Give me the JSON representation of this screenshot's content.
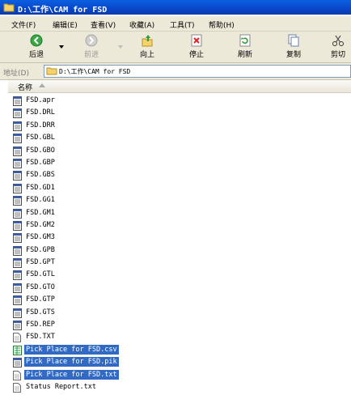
{
  "window": {
    "title": "D:\\工作\\CAM for FSD"
  },
  "menu": [
    "文件(F)",
    "编辑(E)",
    "查看(V)",
    "收藏(A)",
    "工具(T)",
    "帮助(H)"
  ],
  "toolbar": {
    "back": "后退",
    "forward": "前进",
    "up": "向上",
    "stop": "停止",
    "refresh": "刷新",
    "copy": "复制",
    "cut": "剪切"
  },
  "address": {
    "label": "地址(D)",
    "path": "D:\\工作\\CAM for FSD"
  },
  "list": {
    "column_name": "名称",
    "files": [
      "FSD.apr",
      "FSD.DRL",
      "FSD.DRR",
      "FSD.GBL",
      "FSD.GBO",
      "FSD.GBP",
      "FSD.GBS",
      "FSD.GD1",
      "FSD.GG1",
      "FSD.GM1",
      "FSD.GM2",
      "FSD.GM3",
      "FSD.GPB",
      "FSD.GPT",
      "FSD.GTL",
      "FSD.GTO",
      "FSD.GTP",
      "FSD.GTS",
      "FSD.REP",
      "FSD.TXT",
      "Pick Place for FSD.csv",
      "Pick Place for FSD.pik",
      "Pick Place for FSD.txt",
      "Status Report.txt"
    ],
    "selected": [
      20,
      21,
      22
    ]
  },
  "colors": {
    "title": "#0a4ed0",
    "selection": "#316ac5",
    "chrome": "#ece9d8"
  }
}
